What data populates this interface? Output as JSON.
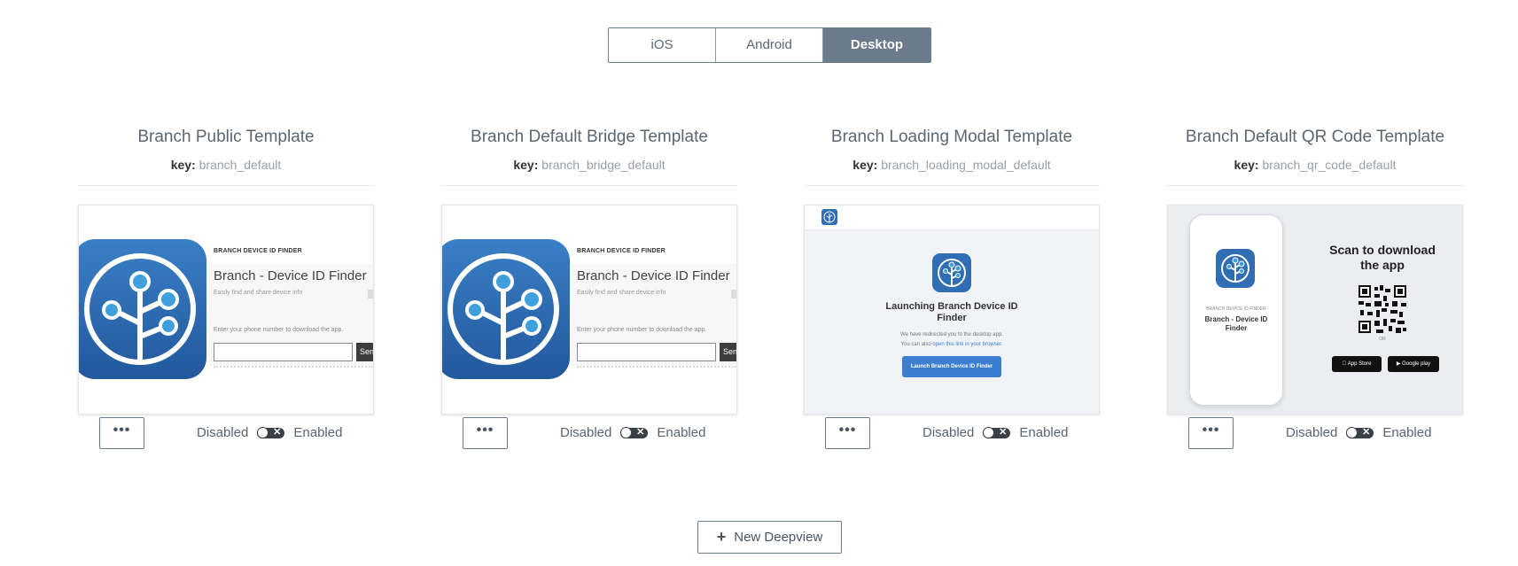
{
  "tabs": [
    "iOS",
    "Android",
    "Desktop"
  ],
  "active_tab": "Desktop",
  "toggle": {
    "off_label": "Disabled",
    "on_label": "Enabled",
    "off_glyph": "✕"
  },
  "more_label": "•••",
  "new_button": {
    "icon": "plus-icon",
    "plus": "+",
    "label": "New Deepview"
  },
  "key_prefix": "key:",
  "templates": [
    {
      "title": "Branch Public Template",
      "key": "branch_default",
      "preview": {
        "heading": "BRANCH DEVICE ID FINDER",
        "app_title": "Branch - Device ID Finder",
        "subtitle": "Easily find and share device info",
        "prompt": "Enter your phone number to download the app.",
        "send": "Sen"
      }
    },
    {
      "title": "Branch Default Bridge Template",
      "key": "branch_bridge_default",
      "preview": {
        "heading": "BRANCH DEVICE ID FINDER",
        "app_title": "Branch - Device ID Finder",
        "subtitle": "Easily find and share device info",
        "prompt": "Enter your phone number to download the app.",
        "send": "Sen"
      }
    },
    {
      "title": "Branch Loading Modal Template",
      "key": "branch_loading_modal_default",
      "preview": {
        "title_line1": "Launching Branch Device ID",
        "title_line2": "Finder",
        "text1": "We have redirected you to the desktop app.",
        "text2_prefix": "You can also ",
        "text2_link": "open this link in your browser.",
        "button": "Launch Branch Device ID Finder"
      }
    },
    {
      "title": "Branch Default QR Code Template",
      "key": "branch_qr_code_default",
      "preview": {
        "phone_heading": "BRANCH DEVICE ID FINDER",
        "phone_title_line1": "Branch - Device ID",
        "phone_title_line2": "Finder",
        "scan_line1": "Scan to download",
        "scan_line2": "the app",
        "or": "OR",
        "app_store": "App Store",
        "google_play": "Google play"
      }
    }
  ],
  "colors": {
    "active_tab": "#6b7b8d",
    "brand_blue": "#2f6db5",
    "toggle": "#3a4048"
  }
}
